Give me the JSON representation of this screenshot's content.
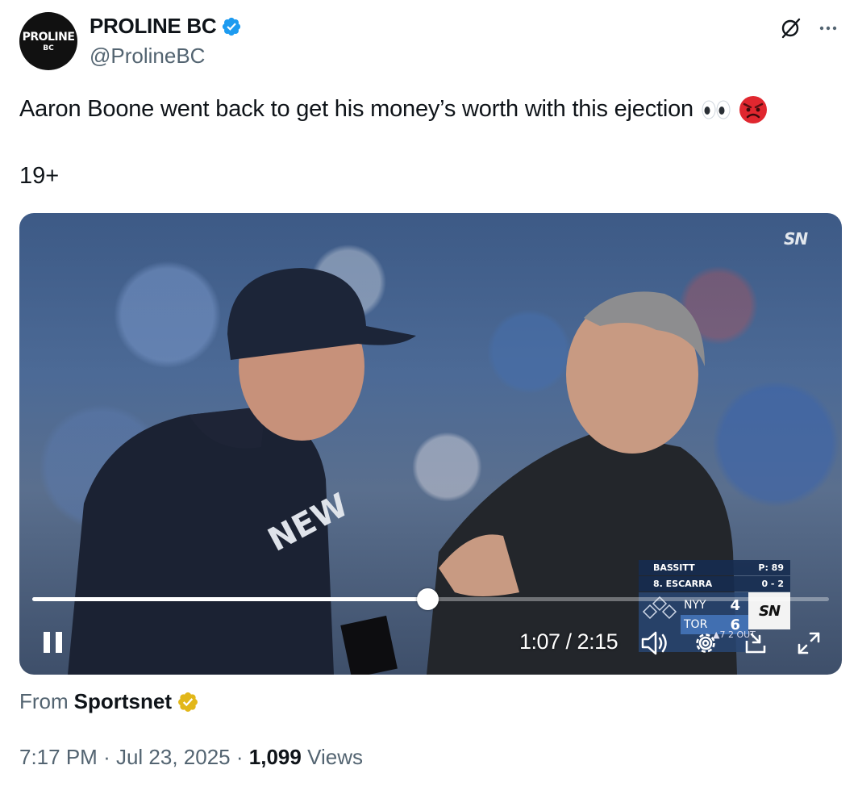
{
  "author": {
    "avatar_line1": "PROLINE",
    "avatar_line2": "BC",
    "name": "PROLINE BC",
    "handle": "@ProlineBC",
    "verified_icon": "blue-verified-badge"
  },
  "header_actions": {
    "grok_icon": "grok-icon",
    "more_icon": "more-horizontal-icon"
  },
  "tweet": {
    "text": "Aaron Boone went back to get his money’s worth with this ejection",
    "emojis": [
      "eyes-emoji",
      "angry-face-emoji"
    ],
    "age_rating": "19+"
  },
  "video": {
    "watermark": "SN",
    "scoreboard": {
      "pitcher": "BASSITT",
      "pitch_count": "P: 89",
      "batter": "8. ESCARRA",
      "count": "0 - 2",
      "teams": [
        {
          "abbr": "NYY",
          "score": "4"
        },
        {
          "abbr": "TOR",
          "score": "6"
        }
      ],
      "logo": "SN",
      "inning_outs": "▲7  2 OUT"
    },
    "progress_fraction": 0.496,
    "time_current": "1:07",
    "time_total": "2:15",
    "time_label": "1:07 / 2:15",
    "controls": [
      "pause-icon",
      "volume-icon",
      "settings-icon",
      "picture-in-picture-icon",
      "fullscreen-icon"
    ]
  },
  "source": {
    "prefix": "From",
    "name": "Sportsnet",
    "badge": "gold-verified-badge"
  },
  "meta": {
    "time": "7:17 PM",
    "separator": "·",
    "date": "Jul 23, 2025",
    "views_count": "1,099",
    "views_label": "Views"
  },
  "colors": {
    "text_primary": "#0f1419",
    "text_secondary": "#536471",
    "verified_blue": "#1d9bf0",
    "gold_badge": "#e2b719"
  }
}
